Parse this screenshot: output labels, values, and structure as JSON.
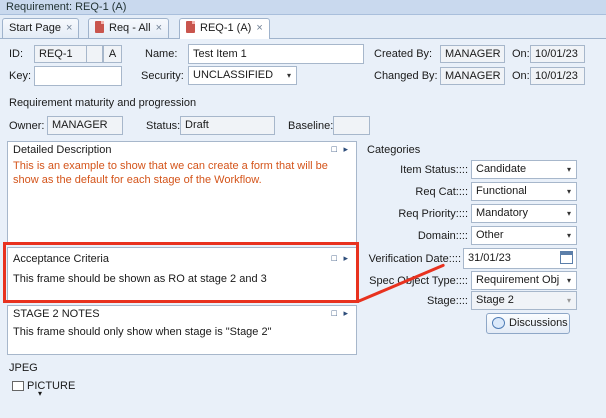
{
  "window": {
    "title": "Requirement: REQ-1 (A)"
  },
  "tabs": [
    {
      "label": "Start Page",
      "close": "×"
    },
    {
      "label": "Req - All",
      "close": "×"
    },
    {
      "label": "REQ-1 (A)",
      "close": "×"
    }
  ],
  "header": {
    "id_label": "ID:",
    "id_value": "REQ-1",
    "rev_value": "A",
    "name_label": "Name:",
    "name_value": "Test Item 1",
    "created_by_label": "Created By:",
    "created_by_value": "MANAGER",
    "created_on_label": "On:",
    "created_on_value": "10/01/23",
    "key_label": "Key:",
    "key_value": "",
    "security_label": "Security:",
    "security_value": "UNCLASSIFIED",
    "changed_by_label": "Changed By:",
    "changed_by_value": "MANAGER",
    "changed_on_label": "On:",
    "changed_on_value": "10/01/23"
  },
  "maturity": {
    "section_title": "Requirement maturity and progression",
    "owner_label": "Owner:",
    "owner_value": "MANAGER",
    "status_label": "Status:",
    "status_value": "Draft",
    "baseline_label": "Baseline:",
    "baseline_value": ""
  },
  "frames": {
    "detailed": {
      "title": "Detailed Description",
      "text": "This is an example to show that we can create a form that will be show as the default for each stage of the Workflow."
    },
    "acceptance": {
      "title": "Acceptance Criteria",
      "text": "This frame should be shown as RO at stage 2 and 3"
    },
    "stage2": {
      "title": "STAGE 2 NOTES",
      "text": "This frame should only show when stage is \"Stage 2\""
    },
    "frame_controls": "□ ▸"
  },
  "jpeg": {
    "label": "JPEG",
    "picture_label": "PICTURE",
    "dropdown_arrow": "▾"
  },
  "categories": {
    "title": "Categories",
    "item_status_label": "Item Status::::",
    "item_status_value": "Candidate",
    "req_cat_label": "Req Cat::::",
    "req_cat_value": "Functional",
    "req_priority_label": "Req Priority::::",
    "req_priority_value": "Mandatory",
    "domain_label": "Domain::::",
    "domain_value": "Other",
    "verification_date_label": "Verification Date::::",
    "verification_date_value": "31/01/23",
    "spec_object_type_label": "Spec Object Type::::",
    "spec_object_type_value": "Requirement Obj",
    "stage_label": "Stage::::",
    "stage_value": "Stage 2",
    "discussions_label": "Discussions",
    "dropdown_arrow": "▾"
  },
  "colors": {
    "highlight": "#e8321f",
    "description_text": "#d4541a"
  }
}
